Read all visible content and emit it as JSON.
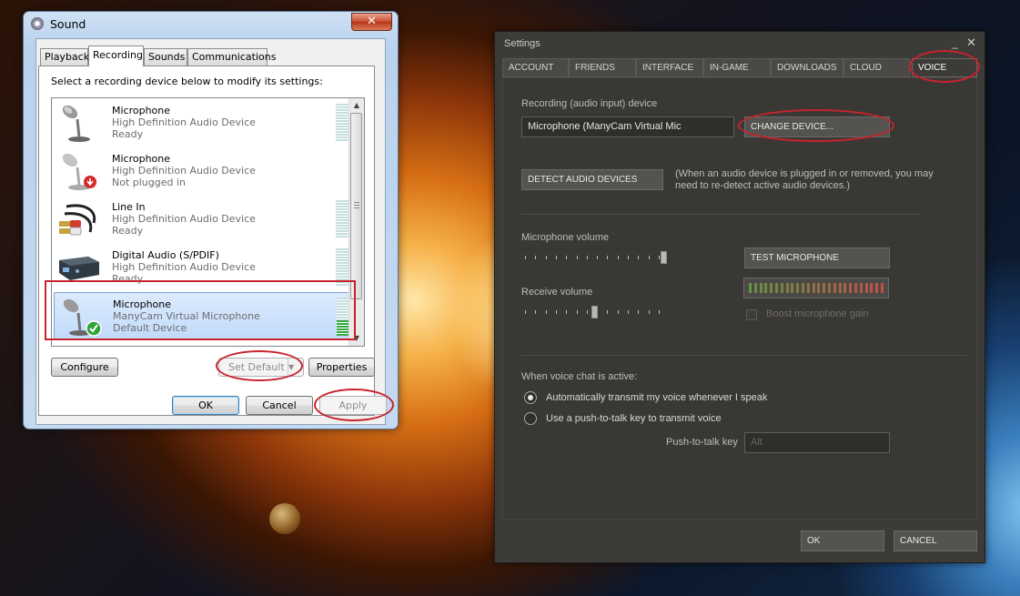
{
  "sound_window": {
    "title": "Sound",
    "close_glyph": "✕",
    "tabs": [
      {
        "label": "Playback"
      },
      {
        "label": "Recording"
      },
      {
        "label": "Sounds"
      },
      {
        "label": "Communications"
      }
    ],
    "instruction": "Select a recording device below to modify its settings:",
    "devices": [
      {
        "name": "Microphone",
        "description": "High Definition Audio Device",
        "status": "Ready",
        "icon": "microphone-icon",
        "level": 0
      },
      {
        "name": "Microphone",
        "description": "High Definition Audio Device",
        "status": "Not plugged in",
        "icon": "microphone-unplugged-icon",
        "level": 0
      },
      {
        "name": "Line In",
        "description": "High Definition Audio Device",
        "status": "Ready",
        "icon": "line-in-cable-icon",
        "level": 0
      },
      {
        "name": "Digital Audio (S/PDIF)",
        "description": "High Definition Audio Device",
        "status": "Ready",
        "icon": "digital-audio-device-icon",
        "level": 0
      },
      {
        "name": "Microphone",
        "description": "ManyCam Virtual Microphone",
        "status": "Default Device",
        "icon": "microphone-default-icon",
        "level": 0.4,
        "selected": true
      }
    ],
    "buttons": {
      "configure": "Configure",
      "set_default": "Set Default",
      "properties": "Properties",
      "ok": "OK",
      "cancel": "Cancel",
      "apply": "Apply"
    }
  },
  "steam_settings": {
    "title": "Settings",
    "minimize_glyph": "_",
    "close_glyph": "✕",
    "tabs": [
      {
        "label": "ACCOUNT"
      },
      {
        "label": "FRIENDS"
      },
      {
        "label": "INTERFACE"
      },
      {
        "label": "IN-GAME"
      },
      {
        "label": "DOWNLOADS"
      },
      {
        "label": "CLOUD"
      },
      {
        "label": "VOICE",
        "active": true
      }
    ],
    "recording_device_label": "Recording (audio input) device",
    "recording_device_value": "Microphone (ManyCam Virtual Mic",
    "change_device_button": "CHANGE DEVICE...",
    "detect_button": "DETECT AUDIO DEVICES",
    "detect_note": "(When an audio device is plugged in or removed, you may need to re-detect active audio devices.)",
    "mic_volume_label": "Microphone volume",
    "mic_volume_level": 1.0,
    "test_mic_button": "TEST MICROPHONE",
    "receive_volume_label": "Receive volume",
    "receive_volume_level": 0.5,
    "boost_label": "Boost microphone gain",
    "voice_active_label": "When voice chat is active:",
    "radio_auto": "Automatically transmit my voice whenever I speak",
    "radio_ptt": "Use a push-to-talk key to transmit voice",
    "ptt_key_label": "Push-to-talk key",
    "ptt_key_value": "Alt",
    "ok_button": "OK",
    "cancel_button": "CANCEL"
  }
}
